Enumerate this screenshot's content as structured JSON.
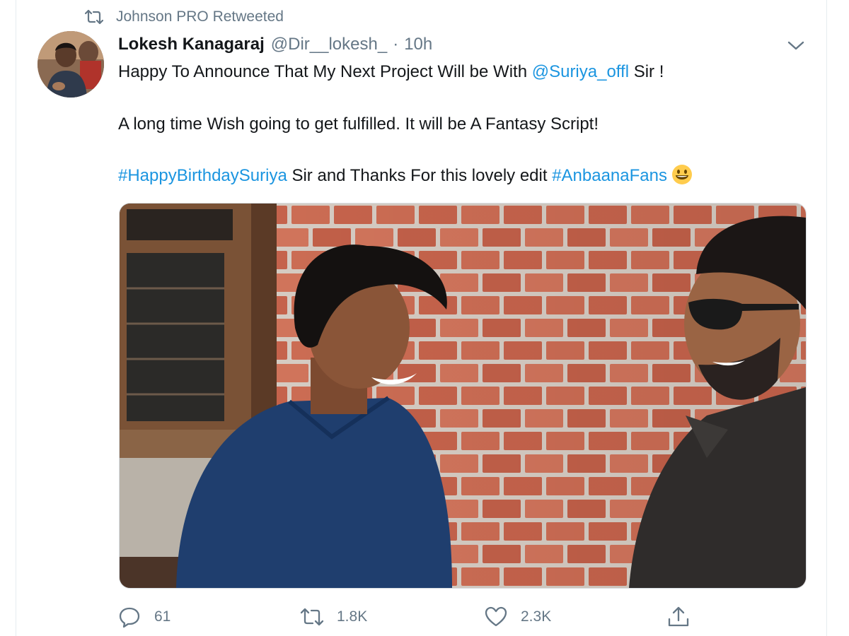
{
  "retweet_context": {
    "label": "Johnson PRO Retweeted"
  },
  "author": {
    "name": "Lokesh Kanagaraj",
    "handle": "@Dir__lokesh_",
    "separator": "·",
    "time": "10h"
  },
  "body": {
    "line1_text": "Happy To Announce That My Next Project Will be With ",
    "line1_mention": "@Suriya_offl",
    "line1_tail": " Sir !",
    "line2_text": "A long time Wish going to get fulfilled. It will be A Fantasy Script!",
    "line3_hashtag1": "#HappyBirthdaySuriya",
    "line3_mid": " Sir and Thanks For this lovely edit ",
    "line3_hashtag2": "#AnbaanaFans",
    "emoji": "grinning-face"
  },
  "actions": {
    "reply_count": "61",
    "retweet_count": "1.8K",
    "like_count": "2.3K"
  },
  "colors": {
    "link": "#1b95e0",
    "muted": "#657786",
    "text": "#14171a"
  },
  "icons": [
    "retweet-icon",
    "chevron-down-icon",
    "reply-icon",
    "retweet-icon",
    "like-icon",
    "share-icon"
  ]
}
